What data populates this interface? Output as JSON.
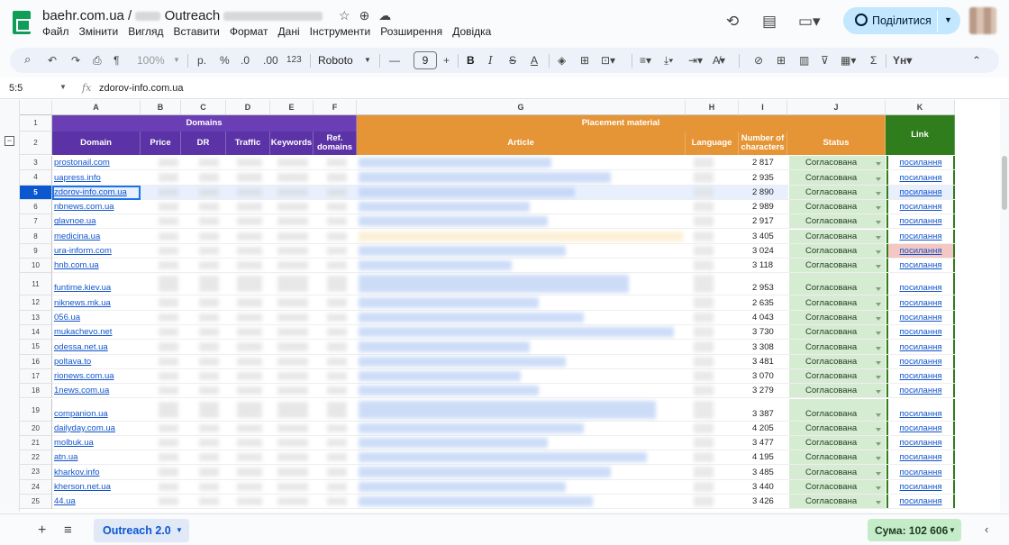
{
  "title": {
    "prefix": "baehr.com.ua / ",
    "name": "Outreach"
  },
  "menu": [
    "Файл",
    "Змінити",
    "Вигляд",
    "Вставити",
    "Формат",
    "Дані",
    "Інструменти",
    "Розширення",
    "Довідка"
  ],
  "share": {
    "label": "Поділитися"
  },
  "toolbar": {
    "zoom": "100%",
    "currency": "р.",
    "percent": "%",
    "dec_less": ".0",
    "dec_more": ".00",
    "format_123": "123",
    "font": "Roboto",
    "font_size": "9"
  },
  "formula": {
    "cell": "5:5",
    "fx": "fx",
    "value": "zdorov-info.com.ua"
  },
  "columns": [
    "A",
    "B",
    "C",
    "D",
    "E",
    "F",
    "G",
    "H",
    "I",
    "J",
    "K"
  ],
  "group_headers": {
    "domains": "Domains",
    "placement": "Placement material",
    "link": "Link"
  },
  "headers": {
    "domain": "Domain",
    "price": "Price",
    "dr": "DR",
    "traffic": "Traffic",
    "keywords": "Keywords",
    "ref_domains": "Ref. domains",
    "article": "Article",
    "language": "Language",
    "chars": "Number of characters",
    "status": "Status"
  },
  "row_numbers": {
    "r1": "1",
    "r2": "2"
  },
  "rows": [
    {
      "n": "3",
      "domain": "prostonail.com",
      "chars": "2 817",
      "status": "Согласована",
      "link": "посилання"
    },
    {
      "n": "4",
      "domain": "uapress.info",
      "chars": "2 935",
      "status": "Согласована",
      "link": "посилання"
    },
    {
      "n": "5",
      "domain": "zdorov-info.com.ua",
      "chars": "2 890",
      "status": "Согласована",
      "link": "посилання"
    },
    {
      "n": "6",
      "domain": "nbnews.com.ua",
      "chars": "2 989",
      "status": "Согласована",
      "link": "посилання"
    },
    {
      "n": "7",
      "domain": "glavnoe.ua",
      "chars": "2 917",
      "status": "Согласована",
      "link": "посилання"
    },
    {
      "n": "8",
      "domain": "medicina.ua",
      "chars": "3 405",
      "status": "Согласована",
      "link": "посилання"
    },
    {
      "n": "9",
      "domain": "ura-inform.com",
      "chars": "3 024",
      "status": "Согласована",
      "link": "посилання"
    },
    {
      "n": "10",
      "domain": "hnb.com.ua",
      "chars": "3 118",
      "status": "Согласована",
      "link": "посилання"
    },
    {
      "n": "11",
      "domain": "funtime.kiev.ua",
      "chars": "2 953",
      "status": "Согласована",
      "link": "посилання"
    },
    {
      "n": "12",
      "domain": "niknews.mk.ua",
      "chars": "2 635",
      "status": "Согласована",
      "link": "посилання"
    },
    {
      "n": "13",
      "domain": "056.ua",
      "chars": "4 043",
      "status": "Согласована",
      "link": "посилання"
    },
    {
      "n": "14",
      "domain": "mukachevo.net",
      "chars": "3 730",
      "status": "Согласована",
      "link": "посилання"
    },
    {
      "n": "15",
      "domain": "odessa.net.ua",
      "chars": "3 308",
      "status": "Согласована",
      "link": "посилання"
    },
    {
      "n": "16",
      "domain": "poltava.to",
      "chars": "3 481",
      "status": "Согласована",
      "link": "посилання"
    },
    {
      "n": "17",
      "domain": "rionews.com.ua",
      "chars": "3 070",
      "status": "Согласована",
      "link": "посилання"
    },
    {
      "n": "18",
      "domain": "1news.com.ua",
      "chars": "3 279",
      "status": "Согласована",
      "link": "посилання"
    },
    {
      "n": "19",
      "domain": "companion.ua",
      "chars": "3 387",
      "status": "Согласована",
      "link": "посилання"
    },
    {
      "n": "20",
      "domain": "dailyday.com.ua",
      "chars": "4 205",
      "status": "Согласована",
      "link": "посилання"
    },
    {
      "n": "21",
      "domain": "molbuk.ua",
      "chars": "3 477",
      "status": "Согласована",
      "link": "посилання"
    },
    {
      "n": "22",
      "domain": "atn.ua",
      "chars": "4 195",
      "status": "Согласована",
      "link": "посилання"
    },
    {
      "n": "23",
      "domain": "kharkov.info",
      "chars": "3 485",
      "status": "Согласована",
      "link": "посилання"
    },
    {
      "n": "24",
      "domain": "kherson.net.ua",
      "chars": "3 440",
      "status": "Согласована",
      "link": "посилання"
    },
    {
      "n": "25",
      "domain": "44.ua",
      "chars": "3 426",
      "status": "Согласована",
      "link": "посилання"
    }
  ],
  "sheet_tab": "Outreach 2.0",
  "sum": "Сума: 102 606",
  "colors": {
    "domains_header": "#6a3fb5",
    "placement_header": "#e69536",
    "link_header": "#2f7d1c",
    "status_fill": "#d6ecd2",
    "accent": "#0b57d0"
  }
}
